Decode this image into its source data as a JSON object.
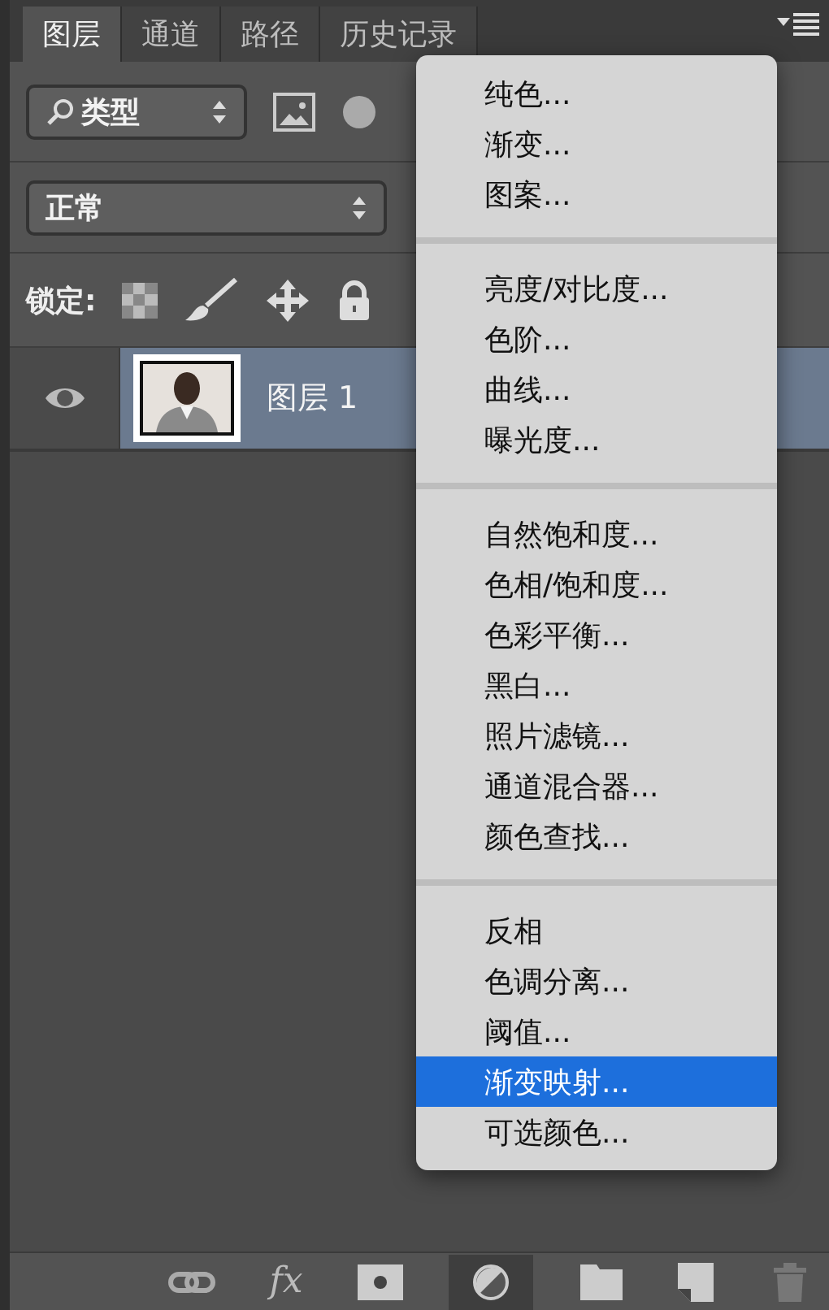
{
  "tabs": [
    {
      "label": "图层",
      "selected": true
    },
    {
      "label": "通道",
      "selected": false
    },
    {
      "label": "路径",
      "selected": false
    },
    {
      "label": "历史记录",
      "selected": false
    }
  ],
  "filter": {
    "value": "类型"
  },
  "blend_mode": {
    "value": "正常"
  },
  "lock_label": "锁定:",
  "layers": [
    {
      "name": "图层 1",
      "visible": true,
      "selected": true
    }
  ],
  "menu": [
    [
      {
        "label": "纯色...",
        "selected": false
      },
      {
        "label": "渐变...",
        "selected": false
      },
      {
        "label": "图案...",
        "selected": false
      }
    ],
    [
      {
        "label": "亮度/对比度...",
        "selected": false
      },
      {
        "label": "色阶...",
        "selected": false
      },
      {
        "label": "曲线...",
        "selected": false
      },
      {
        "label": "曝光度...",
        "selected": false
      }
    ],
    [
      {
        "label": "自然饱和度...",
        "selected": false
      },
      {
        "label": "色相/饱和度...",
        "selected": false
      },
      {
        "label": "色彩平衡...",
        "selected": false
      },
      {
        "label": "黑白...",
        "selected": false
      },
      {
        "label": "照片滤镜...",
        "selected": false
      },
      {
        "label": "通道混合器...",
        "selected": false
      },
      {
        "label": "颜色查找...",
        "selected": false
      }
    ],
    [
      {
        "label": "反相",
        "selected": false
      },
      {
        "label": "色调分离...",
        "selected": false
      },
      {
        "label": "阈值...",
        "selected": false
      },
      {
        "label": "渐变映射...",
        "selected": true
      },
      {
        "label": "可选颜色...",
        "selected": false
      }
    ]
  ],
  "fx_label": "fx"
}
